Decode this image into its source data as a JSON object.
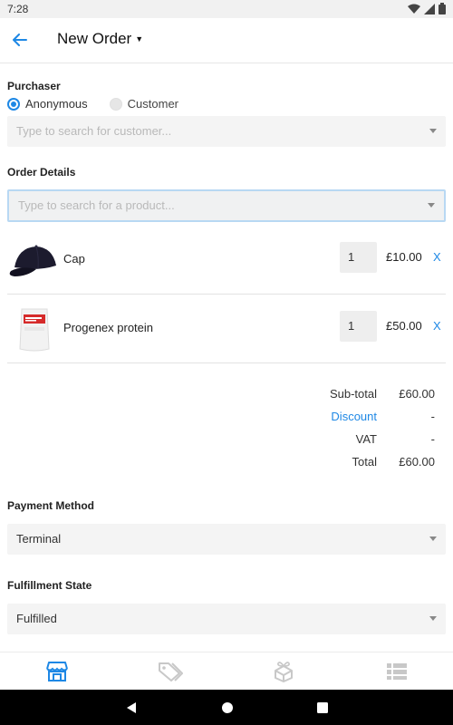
{
  "status_bar": {
    "time": "7:28"
  },
  "header": {
    "title": "New Order"
  },
  "purchaser": {
    "label": "Purchaser",
    "options": [
      {
        "label": "Anonymous",
        "selected": true
      },
      {
        "label": "Customer",
        "selected": false
      }
    ],
    "search_placeholder": "Type to search for customer..."
  },
  "order_details": {
    "label": "Order Details",
    "product_search_placeholder": "Type to search for a product...",
    "items": [
      {
        "name": "Cap",
        "qty": "1",
        "price": "£10.00",
        "remove": "X",
        "image": "cap-image"
      },
      {
        "name": "Progenex protein",
        "qty": "1",
        "price": "£50.00",
        "remove": "X",
        "image": "protein-pouch-image"
      }
    ]
  },
  "totals": {
    "subtotal_label": "Sub-total",
    "subtotal_value": "£60.00",
    "discount_label": "Discount",
    "discount_value": "-",
    "vat_label": "VAT",
    "vat_value": "-",
    "total_label": "Total",
    "total_value": "£60.00"
  },
  "payment": {
    "label": "Payment Method",
    "value": "Terminal"
  },
  "fulfillment": {
    "label": "Fulfillment State",
    "value": "Fulfilled"
  },
  "bottom_nav": {
    "tabs": [
      {
        "icon": "store-icon",
        "active": true
      },
      {
        "icon": "tag-icon",
        "active": false
      },
      {
        "icon": "gift-icon",
        "active": false
      },
      {
        "icon": "list-icon",
        "active": false
      }
    ]
  },
  "colors": {
    "accent": "#1e88e5",
    "inactive_icon": "#c8c8c8",
    "field_bg": "#f4f4f4"
  }
}
